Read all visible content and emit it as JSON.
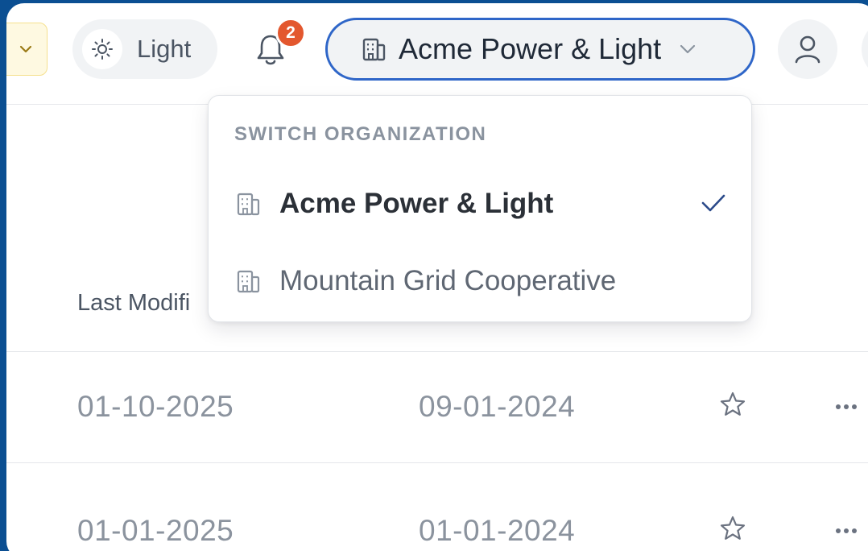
{
  "header": {
    "theme_label": "Light",
    "notifications_count": "2",
    "current_org": "Acme Power & Light"
  },
  "dropdown": {
    "title": "SWITCH ORGANIZATION",
    "items": [
      {
        "label": "Acme Power & Light",
        "selected": true
      },
      {
        "label": "Mountain Grid Cooperative",
        "selected": false
      }
    ]
  },
  "table": {
    "column_header": "Last Modifi",
    "rows": [
      {
        "last_modified": "01-10-2025",
        "created": "09-01-2024"
      },
      {
        "last_modified": "01-01-2025",
        "created": "01-01-2024"
      }
    ]
  },
  "colors": {
    "accent": "#2f66c8",
    "badge": "#e3572e",
    "check": "#2b4a8a"
  }
}
